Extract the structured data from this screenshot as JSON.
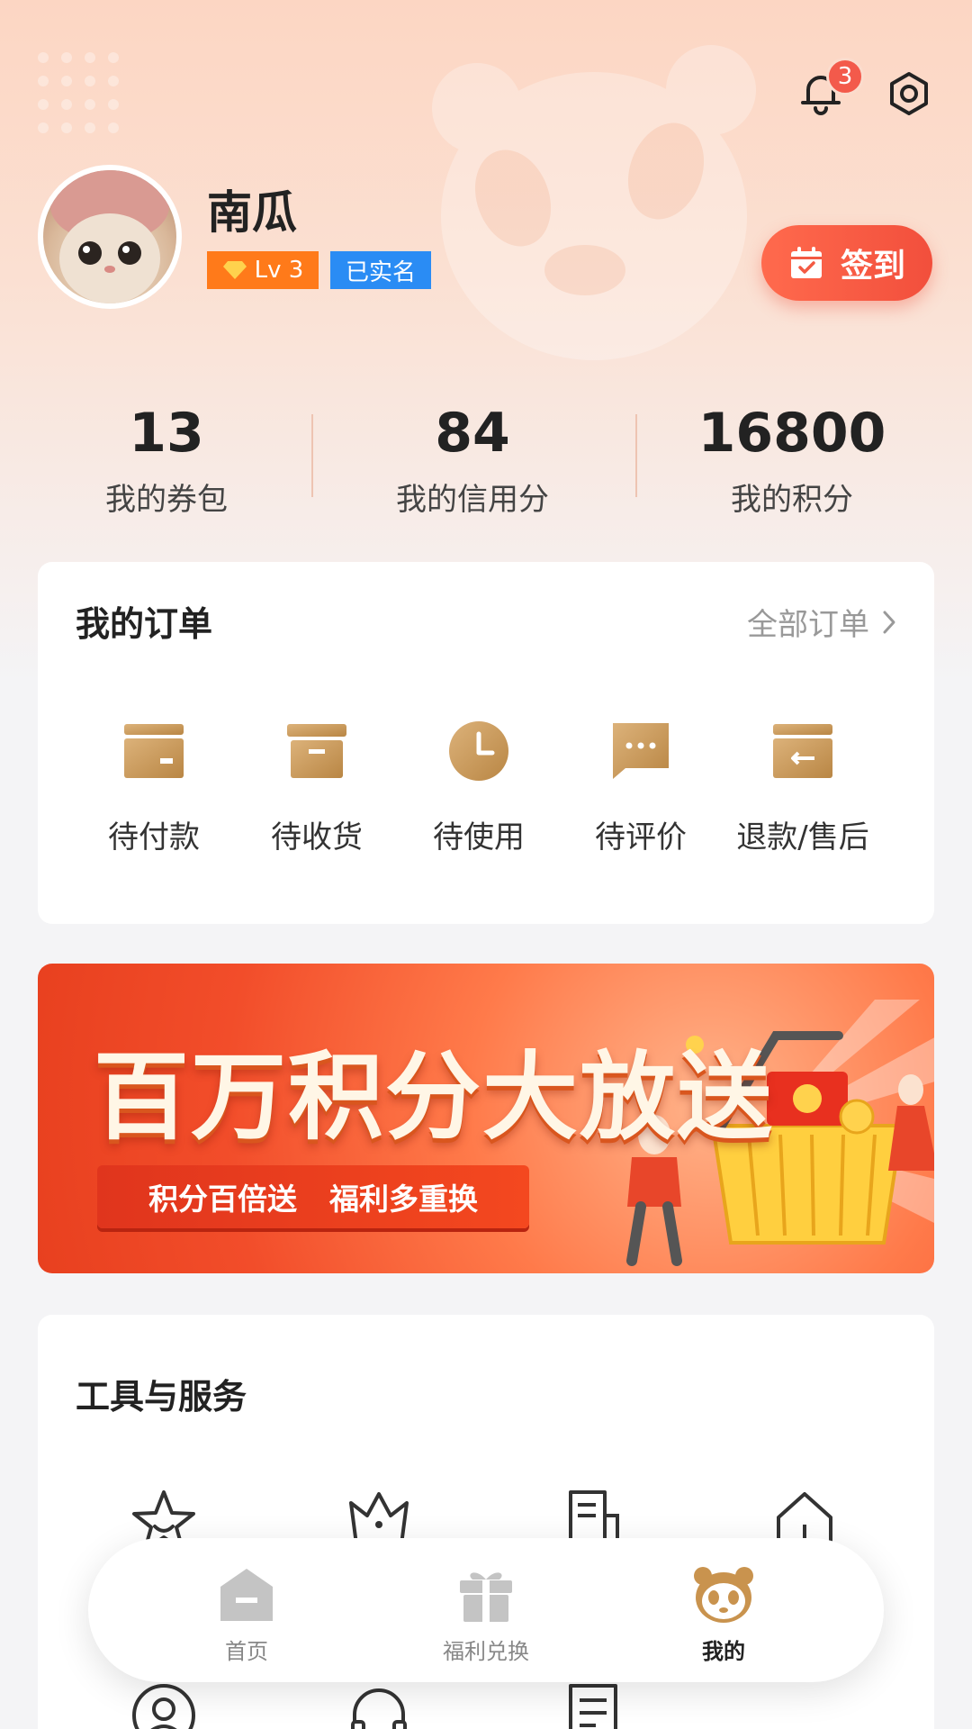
{
  "header": {
    "notification_count": "3",
    "icons": [
      "bell-icon",
      "gear-icon"
    ]
  },
  "profile": {
    "username": "南瓜",
    "level": "Lv 3",
    "verified": "已实名",
    "signin_label": "签到"
  },
  "stats": [
    {
      "value": "13",
      "label": "我的券包"
    },
    {
      "value": "84",
      "label": "我的信用分"
    },
    {
      "value": "16800",
      "label": "我的积分"
    }
  ],
  "orders": {
    "title": "我的订单",
    "all_label": "全部订单",
    "items": [
      {
        "label": "待付款",
        "icon": "wallet-box-icon"
      },
      {
        "label": "待收货",
        "icon": "package-icon"
      },
      {
        "label": "待使用",
        "icon": "clock-icon"
      },
      {
        "label": "待评价",
        "icon": "comment-icon"
      },
      {
        "label": "退款/售后",
        "icon": "refund-icon"
      }
    ]
  },
  "banner": {
    "title": "百万积分大放送",
    "ribbon_left": "积分百倍送",
    "ribbon_right": "福利多重换"
  },
  "tools": {
    "title": "工具与服务",
    "icons": [
      "star-icon",
      "crown-icon",
      "document-icon",
      "home-icon",
      "user-icon",
      "headset-icon",
      "list-icon"
    ]
  },
  "tabbar": {
    "tabs": [
      {
        "label": "首页",
        "icon": "home-tab-icon",
        "active": false
      },
      {
        "label": "福利兑换",
        "icon": "gift-tab-icon",
        "active": false
      },
      {
        "label": "我的",
        "icon": "panda-tab-icon",
        "active": true
      }
    ]
  },
  "colors": {
    "accent": "#f24f3c",
    "gold": "#c9934e",
    "level_badge": "#ff7a1a",
    "verified_badge": "#2a8cf4"
  }
}
